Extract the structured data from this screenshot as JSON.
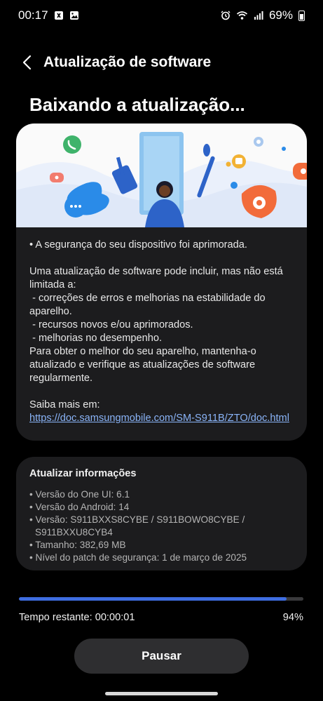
{
  "status_bar": {
    "time": "00:17",
    "battery": "69%"
  },
  "header": {
    "title": "Atualização de software"
  },
  "main": {
    "heading": "Baixando a atualização..."
  },
  "release_notes": {
    "security_line": "• A segurança do seu dispositivo foi aprimorada.",
    "intro": "Uma atualização de software pode incluir, mas não está limitada a:",
    "items": [
      " - correções de erros e melhorias na estabilidade do aparelho.",
      " - recursos novos e/ou aprimorados.",
      " - melhorias no desempenho."
    ],
    "outro": "Para obter o melhor do seu aparelho, mantenha-o atualizado e verifique as atualizações de software regularmente.",
    "more_label": "Saiba mais em:",
    "link": "https://doc.samsungmobile.com/SM-S911B/ZTO/doc.html"
  },
  "update_info": {
    "title": "Atualizar informações",
    "one_ui": "• Versão do One UI: 6.1",
    "android": "• Versão do Android: 14",
    "version": "• Versão: S911BXXS8CYBE / S911BOWO8CYBE /",
    "version_cont": "S911BXXU8CYB4",
    "size": "• Tamanho: 382,69 MB",
    "patch": "• Nível do patch de segurança: 1 de março de 2025"
  },
  "progress": {
    "fraction": 0.94,
    "time_left": "Tempo restante: 00:00:01",
    "percent_label": "94%"
  },
  "actions": {
    "pause_label": "Pausar"
  },
  "colors": {
    "accent": "#3e6de0",
    "link": "#8ab4f8",
    "card": "#1c1c1e"
  }
}
